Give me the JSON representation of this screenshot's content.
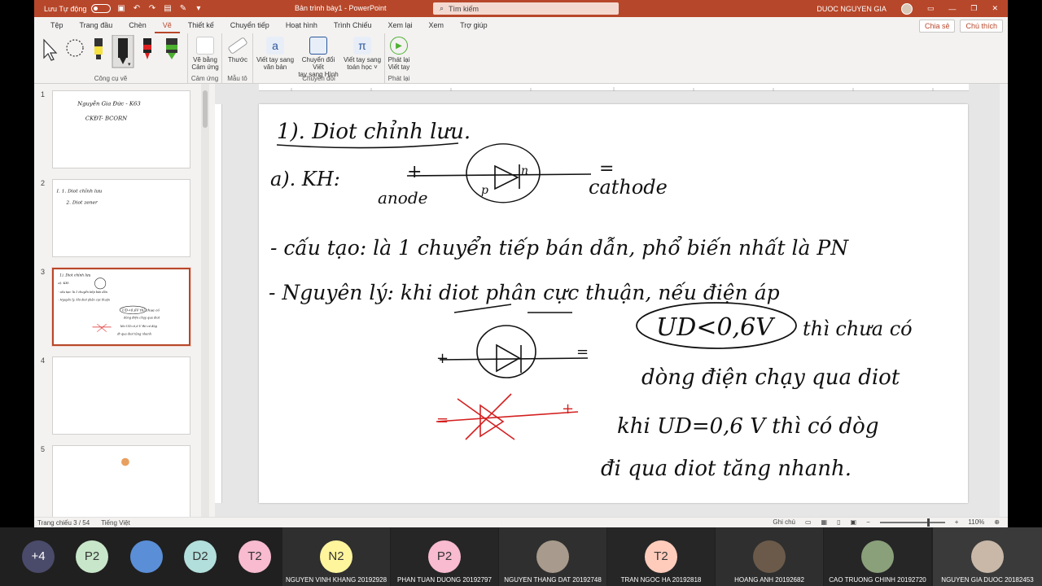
{
  "titlebar": {
    "autosave_label": "Lưu Tự động",
    "document_title": "Bản trình bày1  -  PowerPoint",
    "search_placeholder": "Tìm kiếm",
    "user_name": "DUOC NGUYEN GIA"
  },
  "tabs": [
    "Tệp",
    "Trang đầu",
    "Chèn",
    "Vẽ",
    "Thiết kế",
    "Chuyển tiếp",
    "Hoạt hình",
    "Trình Chiếu",
    "Xem lại",
    "Xem",
    "Trợ giúp"
  ],
  "active_tab": "Vẽ",
  "share": {
    "share_label": "Chia sẻ",
    "comment_label": "Chú thích"
  },
  "ribbon": {
    "groups": {
      "drawing_tools": "Công cụ vẽ",
      "touch": "Cảm ứng",
      "stencils": "Mẫu tô",
      "convert": "Chuyển đổi",
      "replay": "Phát lại"
    },
    "tools": {
      "draw_touch": [
        "Vẽ bằng",
        "Cảm ứng"
      ],
      "ruler": [
        "Thước"
      ],
      "ink_to_text": [
        "Viết tay sang",
        "văn bản"
      ],
      "ink_to_shape": [
        "Chuyển đổi Viết",
        "tay sang Hình"
      ],
      "ink_to_math": [
        "Viết tay sang",
        "toán học ˅"
      ],
      "ink_replay": [
        "Phát lại",
        "Viết tay"
      ]
    },
    "pen_colors": [
      "#222222",
      "#222222",
      "#e02020",
      "#e02020",
      "#4cb030"
    ]
  },
  "thumbnails": [
    {
      "num": "1",
      "lines": [
        "Nguyễn Gia Đức - K63",
        "CKĐT- BCORN"
      ]
    },
    {
      "num": "2",
      "lines": [
        "I.  1. Diot chỉnh lưu",
        "2. Diot zener"
      ]
    },
    {
      "num": "3",
      "lines": [
        "1). Diot chỉnh lưu",
        "a). KH:",
        "- cấu tạo:  là 1 chuyển tiếp bán dẫn",
        "- Nguyên lý:  khi diot phân cực thuận",
        "UD<0,6V thì chưa có",
        "dòng điện chạy qua diot",
        "khi UD=0,6 V thì có dòg",
        "đi qua diot tăng nhanh"
      ]
    },
    {
      "num": "4",
      "lines": []
    },
    {
      "num": "5",
      "lines": []
    }
  ],
  "slide": {
    "title": "1). Diot chỉnh lưu.",
    "kh_label": "a). KH:",
    "plus": "+",
    "minus": "=",
    "anode": "anode",
    "cathode": "cathode",
    "p": "p",
    "n": "n",
    "structure": "- cấu tạo:  là 1 chuyển tiếp bán dẫn, phổ biến nhất là PN",
    "principle": "- Nguyên lý:  khi diot phân cực thuận, nếu điện áp",
    "boxed_formula": "UD<0,6V",
    "line1_rest": "thì chưa có",
    "line2": "dòng điện chạy qua diot",
    "line3": "khi UD=0,6 V thì có dòg",
    "line4": "đi qua diot tăng nhanh."
  },
  "status": {
    "slide_info": "Trang chiếu 3 / 54",
    "language": "Tiếng Việt",
    "notes": "Ghi chú",
    "zoom": "110%"
  },
  "meeting": {
    "circles": [
      {
        "label": "+4",
        "color": "#4a4a6a"
      },
      {
        "label": "P2",
        "color": "#c8e6c9"
      },
      {
        "label": "",
        "color": "#5a8fd8"
      },
      {
        "label": "D2",
        "color": "#b2dfdb"
      },
      {
        "label": "T2",
        "color": "#f8bbd0"
      }
    ],
    "participants": [
      {
        "label": "N2",
        "color": "#fff59d",
        "name": "NGUYEN VINH KHANG 20192928"
      },
      {
        "label": "P2",
        "color": "#f8bbd0",
        "name": "PHAN TUAN DUONG 20192797"
      },
      {
        "label": "",
        "color": "#a89a8c",
        "name": "NGUYEN THANG DAT 20192748"
      },
      {
        "label": "T2",
        "color": "#ffccbc",
        "name": "TRAN NGOC HA 20192818"
      },
      {
        "label": "",
        "color": "#6b5a4a",
        "name": "HOANG ANH 20192682"
      },
      {
        "label": "",
        "color": "#8aa07a",
        "name": "CAO TRUONG CHINH 20192720"
      },
      {
        "label": "",
        "color": "#c9b8a8",
        "name": "NGUYEN GIA DUOC 20182453"
      }
    ]
  }
}
